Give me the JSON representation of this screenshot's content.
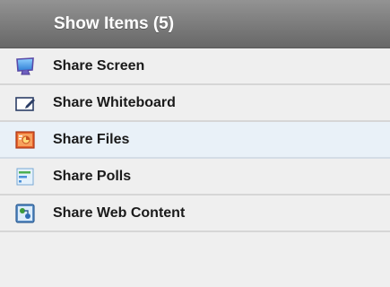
{
  "header": {
    "title": "Show Items (5)"
  },
  "items": [
    {
      "label": "Share Screen",
      "icon": "monitor-icon",
      "selected": false
    },
    {
      "label": "Share Whiteboard",
      "icon": "whiteboard-icon",
      "selected": false
    },
    {
      "label": "Share Files",
      "icon": "presentation-file-icon",
      "selected": true
    },
    {
      "label": "Share Polls",
      "icon": "poll-icon",
      "selected": false
    },
    {
      "label": "Share Web Content",
      "icon": "web-content-icon",
      "selected": false
    }
  ]
}
